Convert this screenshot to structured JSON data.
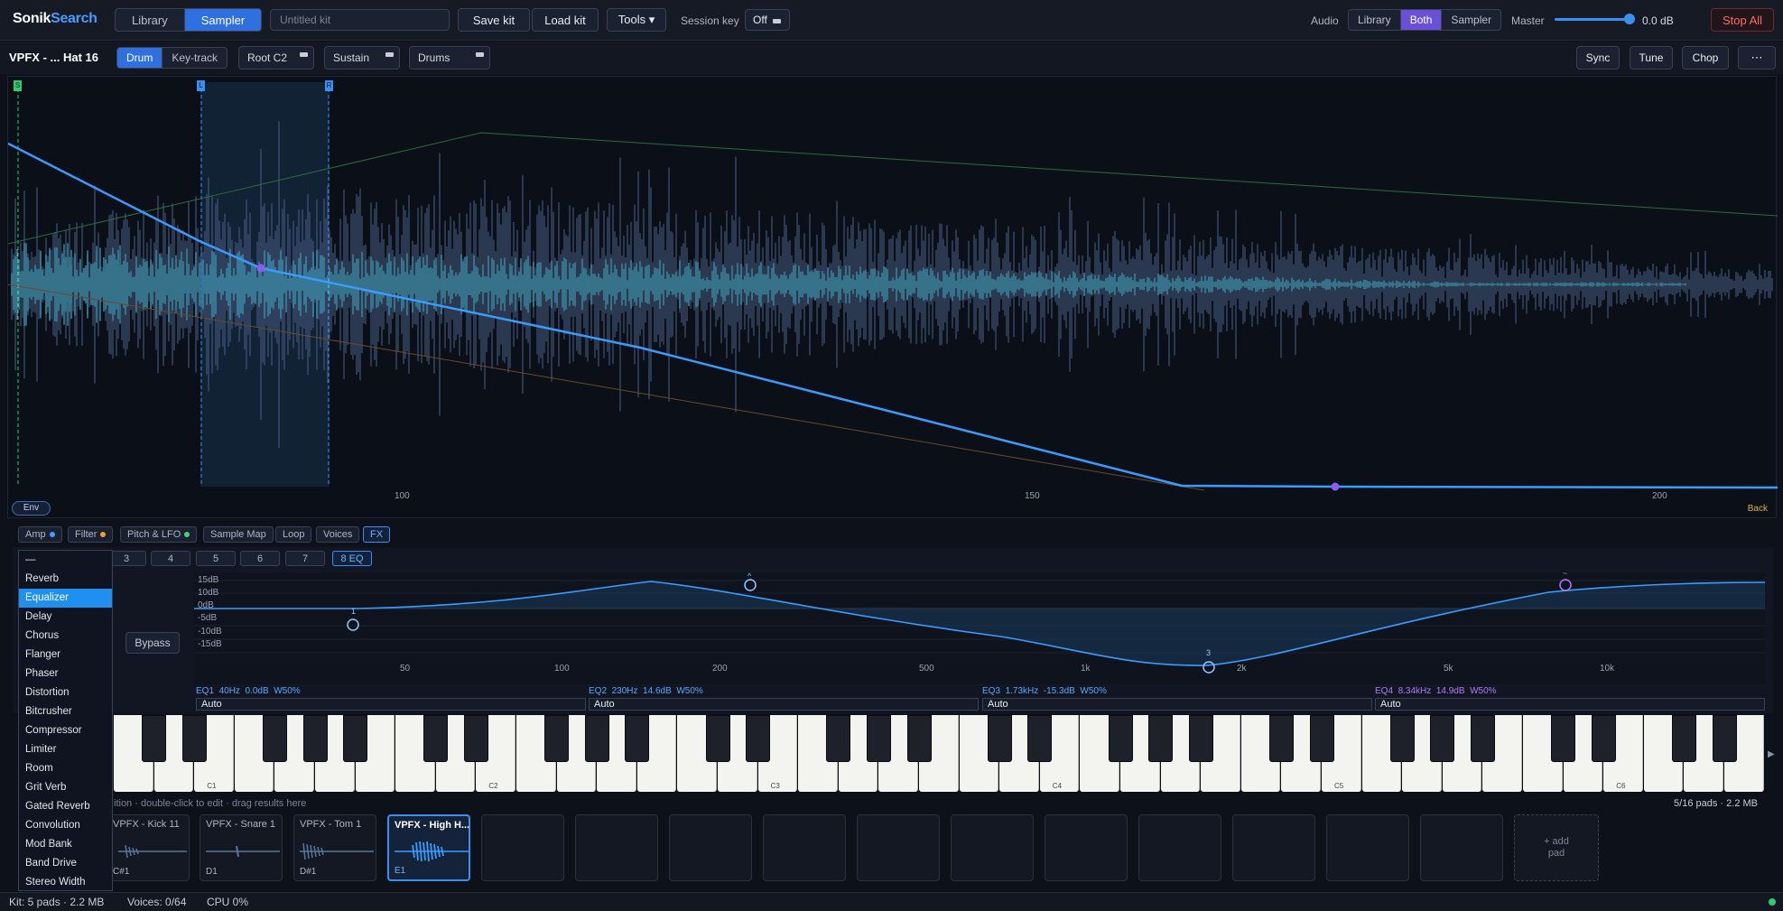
{
  "app": {
    "logo_a": "Sonik",
    "logo_b": "Search"
  },
  "topbar": {
    "mode_tabs": [
      "Library",
      "Sampler"
    ],
    "kit_placeholder": "Untitled kit",
    "save_kit": "Save kit",
    "load_kit": "Load kit",
    "tools": "Tools ▾",
    "session_key_label": "Session key",
    "session_key_value": "Off",
    "audio_label": "Audio",
    "audio_tabs": [
      "Library",
      "Both",
      "Sampler"
    ],
    "master_label": "Master",
    "master_value": "0.0 dB",
    "master_level": 0.97,
    "stop_all": "Stop All"
  },
  "sampler": {
    "sample_name": "VPFX - ... Hat 16",
    "trigger_tabs": [
      "Drum",
      "Key-track"
    ],
    "root": "Root C2",
    "mode": "Sustain",
    "category": "Drums",
    "sync": "Sync",
    "tune": "Tune",
    "chop": "Chop",
    "more": "⋯"
  },
  "waveform": {
    "markers": {
      "start": "S",
      "loop_left": "L",
      "loop_right": "R"
    },
    "ticks": [
      "100",
      "150",
      "200"
    ],
    "env_button": "Env",
    "back_label": "Back"
  },
  "section_tabs": [
    {
      "label": "Amp",
      "dot": "#4a9bff"
    },
    {
      "label": "Filter",
      "dot": "#f0a030"
    },
    {
      "label": "Pitch & LFO",
      "dot": "#40d080"
    },
    {
      "label": "Sample Map",
      "dot": ""
    },
    {
      "label": "Loop",
      "dot": ""
    },
    {
      "label": "Voices",
      "dot": ""
    },
    {
      "label": "FX",
      "dot": ""
    }
  ],
  "fx": {
    "slots": [
      "3",
      "4",
      "5",
      "6",
      "7",
      "8 EQ"
    ],
    "bypass": "Bypass",
    "menu_items": [
      "—",
      "Reverb",
      "Equalizer",
      "Delay",
      "Chorus",
      "Flanger",
      "Phaser",
      "Distortion",
      "Bitcrusher",
      "Compressor",
      "Limiter",
      "Room",
      "Grit Verb",
      "Gated Reverb",
      "Convolution",
      "Mod Bank",
      "Band Drive",
      "Stereo Width"
    ],
    "menu_selected": "Equalizer"
  },
  "eq": {
    "db_labels": [
      "15dB",
      "10dB",
      "0dB",
      "-5dB",
      "-10dB",
      "-15dB"
    ],
    "freq_labels": [
      "50",
      "100",
      "200",
      "500",
      "1k",
      "2k",
      "5k",
      "10k"
    ],
    "node_labels": [
      "1",
      "^",
      "3",
      "~"
    ],
    "bands": [
      {
        "id": "EQ1",
        "freq": "40Hz",
        "gain": "0.0dB",
        "width": "W50%",
        "mode": "Auto",
        "color": "#5aa8ff"
      },
      {
        "id": "EQ2",
        "freq": "230Hz",
        "gain": "14.6dB",
        "width": "W50%",
        "mode": "Auto",
        "color": "#5aa8ff"
      },
      {
        "id": "EQ3",
        "freq": "1.73kHz",
        "gain": "-15.3dB",
        "width": "W50%",
        "mode": "Auto",
        "color": "#5aa8ff"
      },
      {
        "id": "EQ4",
        "freq": "8.34kHz",
        "gain": "14.9dB",
        "width": "W50%",
        "mode": "Auto",
        "color": "#b07cff"
      }
    ]
  },
  "keyboard": {
    "octave_labels": [
      "C1",
      "C2",
      "C3",
      "C4",
      "C5",
      "C6"
    ]
  },
  "pads": {
    "hint": "ition · double-click to edit · drag results here",
    "summary": "5/16 pads · 2.2 MB",
    "items": [
      {
        "name": "VPFX - Kick 11",
        "note": "C#1"
      },
      {
        "name": "VPFX - Snare 1",
        "note": "D1"
      },
      {
        "name": "VPFX - Tom 1",
        "note": "D#1"
      },
      {
        "name": "VPFX - High H...",
        "note": "E1"
      }
    ],
    "add_pad": "+ add pad"
  },
  "status": {
    "kit": "Kit: 5 pads · 2.2 MB",
    "voices": "Voices: 0/64",
    "cpu": "CPU 0%"
  }
}
